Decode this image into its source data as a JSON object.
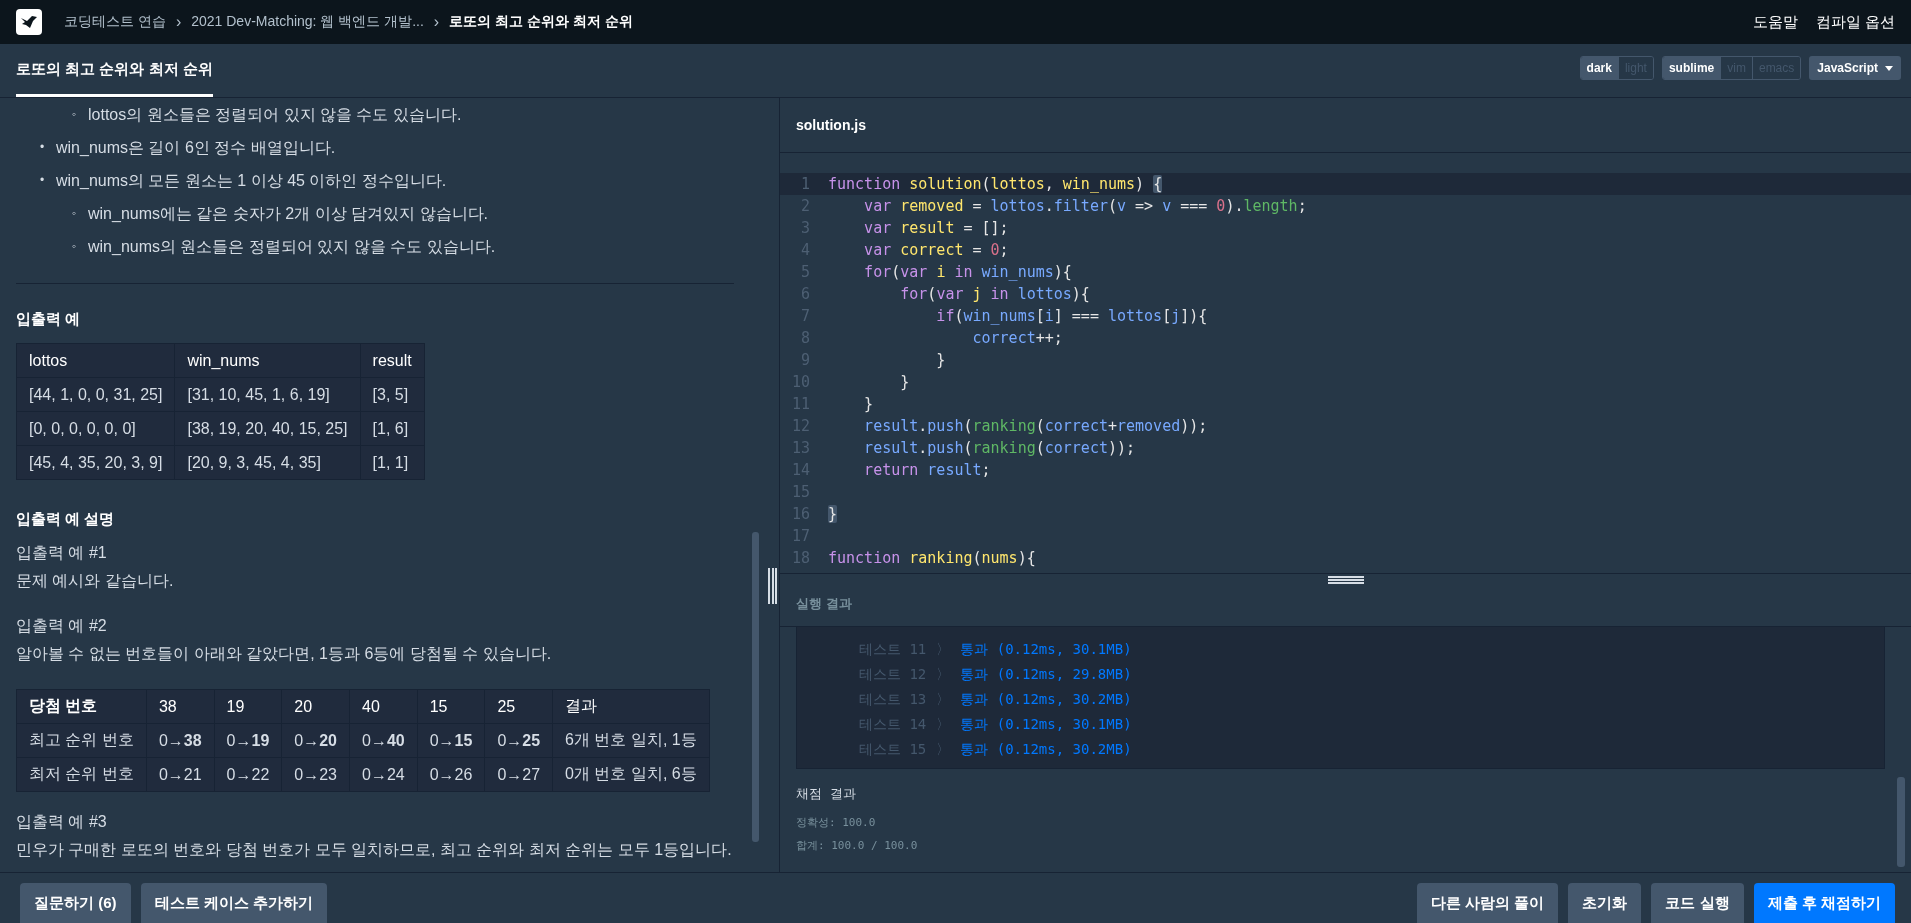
{
  "top_bar": {
    "breadcrumbs": [
      {
        "text": "코딩테스트 연습",
        "current": false
      },
      {
        "text": "2021 Dev-Matching: 웹 백엔드 개발...",
        "current": false
      },
      {
        "text": "로또의 최고 순위와 최저 순위",
        "current": true
      }
    ],
    "separator": "›",
    "links": [
      "도움말",
      "컴파일 옵션"
    ]
  },
  "tab_bar": {
    "tabs": [
      {
        "label": "로또의 최고 순위와 최저 순위",
        "selected": true
      }
    ],
    "toggle_groups": [
      {
        "options": [
          {
            "label": "dark",
            "selected": true
          },
          {
            "label": "light",
            "selected": false
          }
        ]
      },
      {
        "options": [
          {
            "label": "sublime",
            "selected": true
          },
          {
            "label": "vim",
            "selected": false
          },
          {
            "label": "emacs",
            "selected": false
          }
        ]
      }
    ],
    "language": "JavaScript"
  },
  "description": {
    "constraints": [
      {
        "children": [
          {
            "marker": "◦",
            "text": "lottos의 원소들은 정렬되어 있지 않을 수도 있습니다."
          }
        ]
      },
      {
        "marker": "•",
        "text": "win_nums은 길이 6인 정수 배열입니다."
      },
      {
        "marker": "•",
        "text": "win_nums의 모든 원소는 1 이상 45 이하인 정수입니다.",
        "children": [
          {
            "marker": "◦",
            "text": "win_nums에는 같은 숫자가 2개 이상 담겨있지 않습니다."
          },
          {
            "marker": "◦",
            "text": "win_nums의 원소들은 정렬되어 있지 않을 수도 있습니다."
          }
        ]
      }
    ],
    "examples_heading": "입출력 예",
    "examples_table": {
      "columns": [
        "lottos",
        "win_nums",
        "result"
      ],
      "rows": [
        [
          "[44, 1, 0, 0, 31, 25]",
          "[31, 10, 45, 1, 6, 19]",
          "[3, 5]"
        ],
        [
          "[0, 0, 0, 0, 0, 0]",
          "[38, 19, 20, 40, 15, 25]",
          "[1, 6]"
        ],
        [
          "[45, 4, 35, 20, 3, 9]",
          "[20, 9, 3, 45, 4, 35]",
          "[1, 1]"
        ]
      ]
    },
    "explanation_heading": "입출력 예 설명",
    "explanations": [
      {
        "kind": "text",
        "title": "입출력 예 #1",
        "body": "문제 예시와 같습니다."
      },
      {
        "kind": "table",
        "title": "입출력 예 #2",
        "body": "알아볼 수 없는 번호들이 아래와 같았다면, 1등과 6등에 당첨될 수 있습니다.",
        "table": {
          "columns": [
            "당첨 번호",
            "38",
            "19",
            "20",
            "40",
            "15",
            "25",
            "결과"
          ],
          "rows": [
            [
              "최고 순위 번호",
              "0→**38**",
              "0→**19**",
              "0→**20**",
              "0→**40**",
              "0→**15**",
              "0→**25**",
              "6개 번호 일치, 1등"
            ],
            [
              "최저 순위 번호",
              "0→21",
              "0→22",
              "0→23",
              "0→24",
              "0→26",
              "0→27",
              "0개 번호 일치, 6등"
            ]
          ]
        }
      },
      {
        "kind": "text",
        "title": "입출력 예 #3",
        "body": "민우가 구매한 로또의 번호와 당첨 번호가 모두 일치하므로, 최고 순위와 최저 순위는 모두 1등입니다."
      }
    ]
  },
  "editor": {
    "file_name": "solution.js",
    "lines": [
      {
        "number": "1",
        "active": true,
        "tokens": [
          {
            "kind": "kw",
            "text": "function "
          },
          {
            "kind": "dc",
            "text": "solution"
          },
          {
            "kind": "p",
            "text": "("
          },
          {
            "kind": "dc",
            "text": "lottos"
          },
          {
            "kind": "p",
            "text": ", "
          },
          {
            "kind": "dc",
            "text": "win_nums"
          },
          {
            "kind": "p",
            "text": ") "
          },
          {
            "kind": "br",
            "text": "{"
          }
        ]
      },
      {
        "number": "2",
        "active": false,
        "tokens": [
          {
            "kind": "kw",
            "text": "    var "
          },
          {
            "kind": "dc",
            "text": "removed"
          },
          {
            "kind": "p",
            "text": " = "
          },
          {
            "kind": "id",
            "text": "lottos"
          },
          {
            "kind": "p",
            "text": "."
          },
          {
            "kind": "id",
            "text": "filter"
          },
          {
            "kind": "p",
            "text": "("
          },
          {
            "kind": "id",
            "text": "v"
          },
          {
            "kind": "p",
            "text": " => "
          },
          {
            "kind": "id",
            "text": "v"
          },
          {
            "kind": "p",
            "text": " === "
          },
          {
            "kind": "num",
            "text": "0"
          },
          {
            "kind": "p",
            "text": ")."
          },
          {
            "kind": "fn",
            "text": "length"
          },
          {
            "kind": "p",
            "text": ";"
          }
        ]
      },
      {
        "number": "3",
        "active": false,
        "tokens": [
          {
            "kind": "kw",
            "text": "    var "
          },
          {
            "kind": "dc",
            "text": "result"
          },
          {
            "kind": "p",
            "text": " = [];"
          }
        ]
      },
      {
        "number": "4",
        "active": false,
        "tokens": [
          {
            "kind": "kw",
            "text": "    var "
          },
          {
            "kind": "dc",
            "text": "correct"
          },
          {
            "kind": "p",
            "text": " = "
          },
          {
            "kind": "num",
            "text": "0"
          },
          {
            "kind": "p",
            "text": ";"
          }
        ]
      },
      {
        "number": "5",
        "active": false,
        "tokens": [
          {
            "kind": "kw",
            "text": "    for"
          },
          {
            "kind": "p",
            "text": "("
          },
          {
            "kind": "kw",
            "text": "var "
          },
          {
            "kind": "dc",
            "text": "i "
          },
          {
            "kind": "kw",
            "text": "in "
          },
          {
            "kind": "id",
            "text": "win_nums"
          },
          {
            "kind": "p",
            "text": "){"
          }
        ]
      },
      {
        "number": "6",
        "active": false,
        "tokens": [
          {
            "kind": "kw",
            "text": "        for"
          },
          {
            "kind": "p",
            "text": "("
          },
          {
            "kind": "kw",
            "text": "var "
          },
          {
            "kind": "dc",
            "text": "j "
          },
          {
            "kind": "kw",
            "text": "in "
          },
          {
            "kind": "id",
            "text": "lottos"
          },
          {
            "kind": "p",
            "text": "){"
          }
        ]
      },
      {
        "number": "7",
        "active": false,
        "tokens": [
          {
            "kind": "kw",
            "text": "            if"
          },
          {
            "kind": "p",
            "text": "("
          },
          {
            "kind": "id",
            "text": "win_nums"
          },
          {
            "kind": "p",
            "text": "["
          },
          {
            "kind": "id",
            "text": "i"
          },
          {
            "kind": "p",
            "text": "] === "
          },
          {
            "kind": "id",
            "text": "lottos"
          },
          {
            "kind": "p",
            "text": "["
          },
          {
            "kind": "id",
            "text": "j"
          },
          {
            "kind": "p",
            "text": "]){"
          }
        ]
      },
      {
        "number": "8",
        "active": false,
        "tokens": [
          {
            "kind": "id",
            "text": "                correct"
          },
          {
            "kind": "p",
            "text": "++;"
          }
        ]
      },
      {
        "number": "9",
        "active": false,
        "tokens": [
          {
            "kind": "p",
            "text": "            }"
          }
        ]
      },
      {
        "number": "10",
        "active": false,
        "tokens": [
          {
            "kind": "p",
            "text": "        }"
          }
        ]
      },
      {
        "number": "11",
        "active": false,
        "tokens": [
          {
            "kind": "p",
            "text": "    }"
          }
        ]
      },
      {
        "number": "12",
        "active": false,
        "tokens": [
          {
            "kind": "id",
            "text": "    result"
          },
          {
            "kind": "p",
            "text": "."
          },
          {
            "kind": "id",
            "text": "push"
          },
          {
            "kind": "p",
            "text": "("
          },
          {
            "kind": "fn",
            "text": "ranking"
          },
          {
            "kind": "p",
            "text": "("
          },
          {
            "kind": "id",
            "text": "correct"
          },
          {
            "kind": "p",
            "text": "+"
          },
          {
            "kind": "id",
            "text": "removed"
          },
          {
            "kind": "p",
            "text": "));"
          }
        ]
      },
      {
        "number": "13",
        "active": false,
        "tokens": [
          {
            "kind": "id",
            "text": "    result"
          },
          {
            "kind": "p",
            "text": "."
          },
          {
            "kind": "id",
            "text": "push"
          },
          {
            "kind": "p",
            "text": "("
          },
          {
            "kind": "fn",
            "text": "ranking"
          },
          {
            "kind": "p",
            "text": "("
          },
          {
            "kind": "id",
            "text": "correct"
          },
          {
            "kind": "p",
            "text": "));"
          }
        ]
      },
      {
        "number": "14",
        "active": false,
        "tokens": [
          {
            "kind": "kw",
            "text": "    return "
          },
          {
            "kind": "id",
            "text": "result"
          },
          {
            "kind": "p",
            "text": ";"
          }
        ]
      },
      {
        "number": "15",
        "active": false
      },
      {
        "number": "16",
        "active": false,
        "tokens": [
          {
            "kind": "br",
            "text": "}"
          }
        ]
      },
      {
        "number": "17",
        "active": false
      },
      {
        "number": "18",
        "active": false,
        "tokens": [
          {
            "kind": "kw",
            "text": "function "
          },
          {
            "kind": "dc",
            "text": "ranking"
          },
          {
            "kind": "p",
            "text": "("
          },
          {
            "kind": "dc",
            "text": "nums"
          },
          {
            "kind": "p",
            "text": "){"
          }
        ]
      }
    ]
  },
  "results": {
    "title": "실행 결과",
    "tests": [
      {
        "label": "테스트 11",
        "separator": "〉",
        "result": "통과 (0.12ms, 30.1MB)"
      },
      {
        "label": "테스트 12",
        "separator": "〉",
        "result": "통과 (0.12ms, 29.8MB)"
      },
      {
        "label": "테스트 13",
        "separator": "〉",
        "result": "통과 (0.12ms, 30.2MB)"
      },
      {
        "label": "테스트 14",
        "separator": "〉",
        "result": "통과 (0.12ms, 30.1MB)"
      },
      {
        "label": "테스트 15",
        "separator": "〉",
        "result": "통과 (0.12ms, 30.2MB)"
      }
    ],
    "grading_title": "채점 결과",
    "grading_lines": [
      "정확성: 100.0",
      "합계: 100.0 / 100.0"
    ]
  },
  "bottom_bar": {
    "left_buttons": [
      {
        "label": "질문하기 (6)",
        "kind": "default"
      },
      {
        "label": "테스트 케이스 추가하기",
        "kind": "default"
      }
    ],
    "right_buttons": [
      {
        "label": "다른 사람의 풀이",
        "kind": "default"
      },
      {
        "label": "초기화",
        "kind": "default"
      },
      {
        "label": "코드 실행",
        "kind": "default"
      },
      {
        "label": "제출 후 채점하기",
        "kind": "primary"
      }
    ]
  }
}
